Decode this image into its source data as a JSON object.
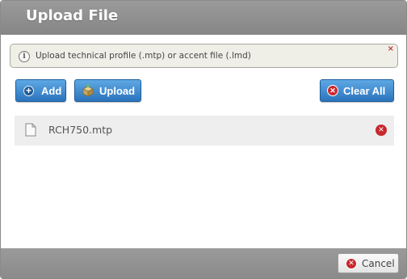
{
  "dialog": {
    "title": "Upload File"
  },
  "info": {
    "text": "Upload technical profile (.mtp) or accent file (.lmd)",
    "icon": "info-icon",
    "close_glyph": "×"
  },
  "toolbar": {
    "add_label": "Add",
    "upload_label": "Upload",
    "clear_all_label": "Clear All"
  },
  "files": [
    {
      "name": "RCH750.mtp"
    }
  ],
  "footer": {
    "cancel_label": "Cancel"
  },
  "colors": {
    "titlebar": "#8e8e8e",
    "button_blue": "#2b74bd",
    "remove_red": "#c8282d"
  }
}
